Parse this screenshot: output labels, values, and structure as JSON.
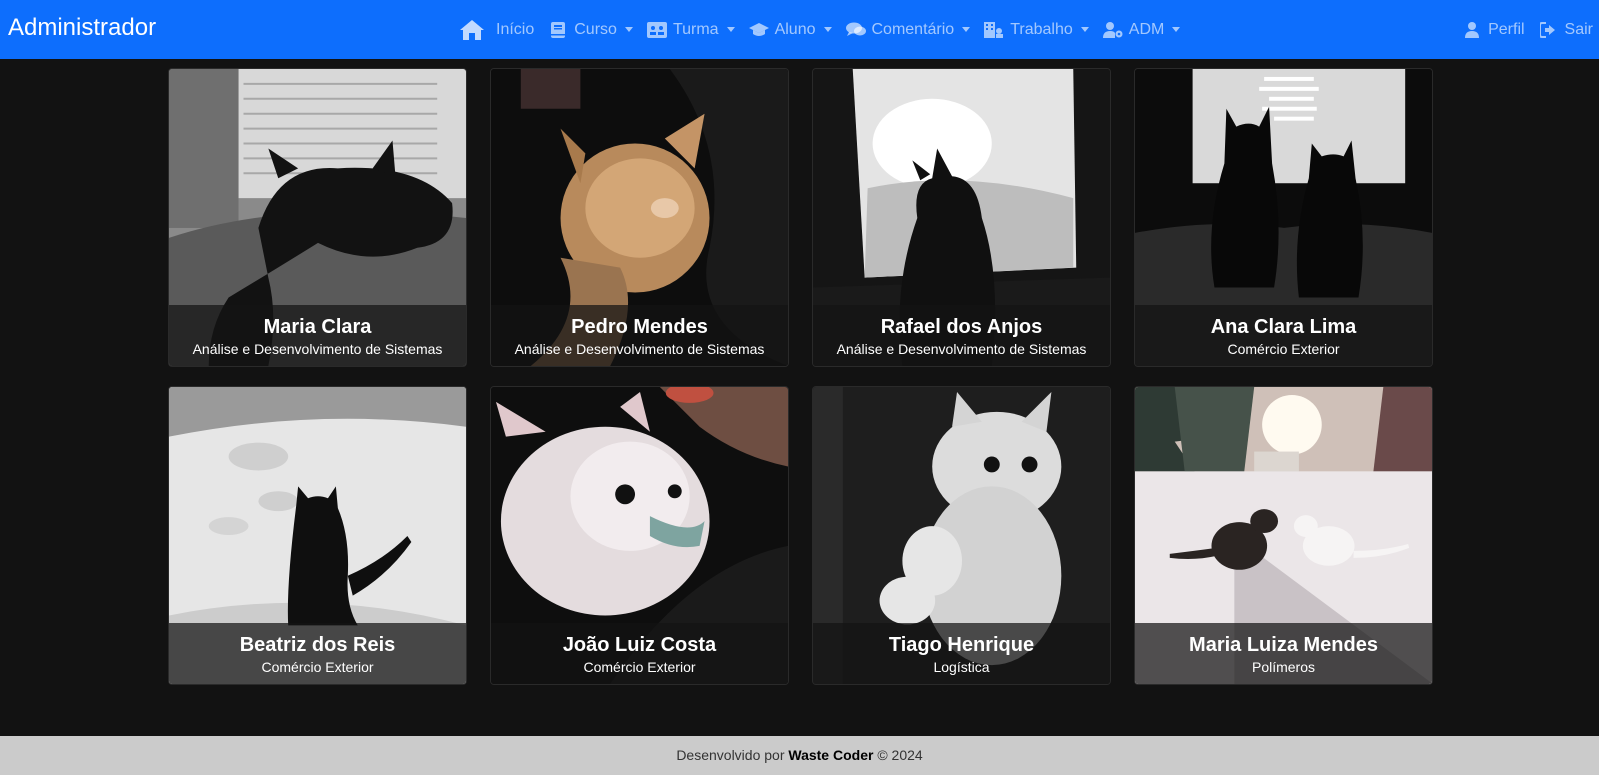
{
  "navbar": {
    "brand": "Administrador",
    "items": [
      {
        "label": "Início",
        "icon": "home-icon",
        "dropdown": false
      },
      {
        "label": "Curso",
        "icon": "book-icon",
        "dropdown": true
      },
      {
        "label": "Turma",
        "icon": "group-icon",
        "dropdown": true
      },
      {
        "label": "Aluno",
        "icon": "graduation-cap-icon",
        "dropdown": true
      },
      {
        "label": "Comentário",
        "icon": "comments-icon",
        "dropdown": true
      },
      {
        "label": "Trabalho",
        "icon": "building-icon",
        "dropdown": true
      },
      {
        "label": "ADM",
        "icon": "user-gear-icon",
        "dropdown": true
      }
    ],
    "right": [
      {
        "label": "Perfil",
        "icon": "user-icon"
      },
      {
        "label": "Sair",
        "icon": "sign-out-icon"
      }
    ],
    "colors": {
      "background": "#0d6efd",
      "link": "rgba(255,255,255,0.62)"
    }
  },
  "students": [
    {
      "name": "Maria Clara",
      "course": "Análise e Desenvolvimento de Sistemas",
      "photo": "black-cat-sleeping-photo"
    },
    {
      "name": "Pedro Mendes",
      "course": "Análise e Desenvolvimento de Sistemas",
      "photo": "orange-kitten-sleeping-photo"
    },
    {
      "name": "Rafael dos Anjos",
      "course": "Análise e Desenvolvimento de Sistemas",
      "photo": "cat-silhouette-window-photo"
    },
    {
      "name": "Ana Clara Lima",
      "course": "Comércio Exterior",
      "photo": "two-cats-window-photo"
    },
    {
      "name": "Beatriz dos Reis",
      "course": "Comércio Exterior",
      "photo": "black-kitten-snow-photo"
    },
    {
      "name": "João Luiz Costa",
      "course": "Comércio Exterior",
      "photo": "white-kitten-held-photo"
    },
    {
      "name": "Tiago Henrique",
      "course": "Logística",
      "photo": "white-kitten-dark-photo"
    },
    {
      "name": "Maria Luiza Mendes",
      "course": "Polímeros",
      "photo": "kittens-snow-sunlight-photo"
    }
  ],
  "footer": {
    "prefix": "Desenvolvido por",
    "author": "Waste Coder",
    "suffix": "© 2024"
  },
  "colors": {
    "page_background": "#121212",
    "footer_background": "#cbcbcb"
  }
}
